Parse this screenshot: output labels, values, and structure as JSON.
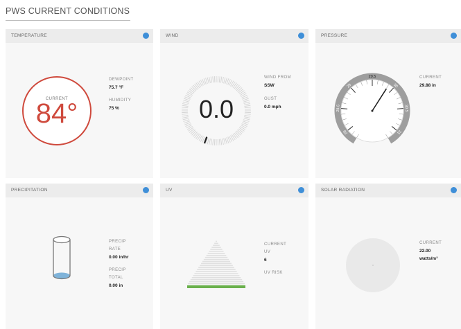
{
  "page": {
    "title": "PWS CURRENT CONDITIONS"
  },
  "colors": {
    "info": "#3f8fd8",
    "temperature_ring": "#cf4a3d",
    "uv_bar": "#6ab04c",
    "rain_fill": "#7fb3d9"
  },
  "temperature": {
    "title": "TEMPERATURE",
    "current_label": "CURRENT",
    "current_value": "84°",
    "dewpoint_label": "DEWPOINT",
    "dewpoint_value": "75.7 °F",
    "humidity_label": "HUMIDITY",
    "humidity_value": "75 %"
  },
  "wind": {
    "title": "WIND",
    "speed": "0.0",
    "from_label": "WIND FROM",
    "from_value": "SSW",
    "gust_label": "GUST",
    "gust_value": "0.0 mph"
  },
  "pressure": {
    "title": "PRESSURE",
    "current_label": "CURRENT",
    "current_value": "29.88 in",
    "gauge_ticks": [
      "29",
      "29.5",
      "30",
      "28.5",
      "30.5",
      "28",
      "31"
    ],
    "needle_value": 29.88
  },
  "precipitation": {
    "title": "PRECIPITATION",
    "rate_label_1": "PRECIP",
    "rate_label_2": "RATE",
    "rate_value": "0.00 in/hr",
    "total_label_1": "PRECIP",
    "total_label_2": "TOTAL",
    "total_value": "0.00 in"
  },
  "uv": {
    "title": "UV",
    "current_label_1": "CURRENT",
    "current_label_2": "UV",
    "current_value": "6",
    "risk_label": "UV RISK"
  },
  "solar": {
    "title": "SOLAR RADIATION",
    "current_label": "CURRENT",
    "current_value": "22.00",
    "unit": "watts/m²"
  }
}
